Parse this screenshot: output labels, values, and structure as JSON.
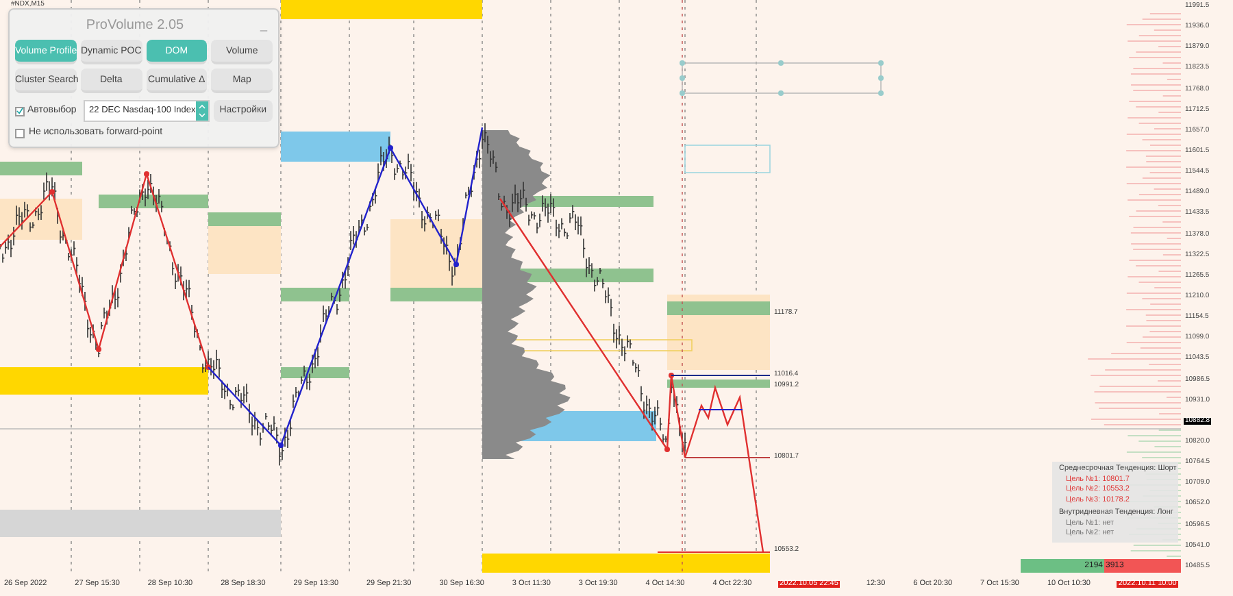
{
  "symbol": "#NDX,M15",
  "panel": {
    "title": "ProVolume 2.05",
    "minimize": "_",
    "modes": [
      {
        "label": "Volume Profile",
        "selected": true
      },
      {
        "label": "Dynamic POC",
        "selected": false
      },
      {
        "label": "DOM",
        "selected": true
      },
      {
        "label": "Volume",
        "selected": false
      },
      {
        "label": "Cluster Search",
        "selected": false
      },
      {
        "label": "Delta",
        "selected": false
      },
      {
        "label": "Cumulative Δ",
        "selected": false
      },
      {
        "label": "Map",
        "selected": false
      }
    ],
    "autoselect": {
      "label": "Автовыбор",
      "checked": true
    },
    "instrument": {
      "value": "22 DEC Nasdaq-100 Index"
    },
    "settings_button": "Настройки",
    "forward_point": {
      "label": "Не использовать forward-point",
      "checked": false
    }
  },
  "level_labels": [
    "11178.7",
    "11016.4",
    "10991.2",
    "10801.7",
    "10553.2"
  ],
  "price_axis": [
    {
      "label": "11991.5",
      "current": false
    },
    {
      "label": "11936.0",
      "current": false
    },
    {
      "label": "11879.0",
      "current": false
    },
    {
      "label": "11823.5",
      "current": false
    },
    {
      "label": "11768.0",
      "current": false
    },
    {
      "label": "11712.5",
      "current": false
    },
    {
      "label": "11657.0",
      "current": false
    },
    {
      "label": "11601.5",
      "current": false
    },
    {
      "label": "11544.5",
      "current": false
    },
    {
      "label": "11489.0",
      "current": false
    },
    {
      "label": "11433.5",
      "current": false
    },
    {
      "label": "11378.0",
      "current": false
    },
    {
      "label": "11322.5",
      "current": false
    },
    {
      "label": "11265.5",
      "current": false
    },
    {
      "label": "11210.0",
      "current": false
    },
    {
      "label": "11154.5",
      "current": false
    },
    {
      "label": "11099.0",
      "current": false
    },
    {
      "label": "11043.5",
      "current": false
    },
    {
      "label": "10986.5",
      "current": false
    },
    {
      "label": "10931.0",
      "current": false
    },
    {
      "label": "10882.8",
      "current": true
    },
    {
      "label": "10820.0",
      "current": false
    },
    {
      "label": "10764.5",
      "current": false
    },
    {
      "label": "10709.0",
      "current": false
    },
    {
      "label": "10652.0",
      "current": false
    },
    {
      "label": "10596.5",
      "current": false
    },
    {
      "label": "10541.0",
      "current": false
    },
    {
      "label": "10485.5",
      "current": false
    }
  ],
  "time_axis": [
    {
      "label": "26 Sep 2022",
      "highlighted": false
    },
    {
      "label": "27 Sep 15:30",
      "highlighted": false
    },
    {
      "label": "28 Sep 10:30",
      "highlighted": false
    },
    {
      "label": "28 Sep 18:30",
      "highlighted": false
    },
    {
      "label": "29 Sep 13:30",
      "highlighted": false
    },
    {
      "label": "29 Sep 21:30",
      "highlighted": false
    },
    {
      "label": "30 Sep 16:30",
      "highlighted": false
    },
    {
      "label": "3 Oct 11:30",
      "highlighted": false
    },
    {
      "label": "3 Oct 19:30",
      "highlighted": false
    },
    {
      "label": "4 Oct 14:30",
      "highlighted": false
    },
    {
      "label": "4 Oct 22:30",
      "highlighted": false
    },
    {
      "label": "2022.10.05 22:45",
      "highlighted": true
    },
    {
      "label": "12:30",
      "highlighted": false
    },
    {
      "label": "6 Oct 20:30",
      "highlighted": false
    },
    {
      "label": "7 Oct 15:30",
      "highlighted": false
    },
    {
      "label": "10 Oct 10:30",
      "highlighted": false
    },
    {
      "label": "2022.10.11 10:00",
      "highlighted": true
    }
  ],
  "trend_box": {
    "sections": [
      {
        "title": "Среднесрочная Тенденция: Шорт",
        "targets": [
          {
            "label": "Цель №1: 10801.7",
            "color": "#e03c3c"
          },
          {
            "label": "Цель №2: 10553.2",
            "color": "#e03c3c"
          },
          {
            "label": "Цель №3: 10178.2",
            "color": "#e03c3c"
          }
        ]
      },
      {
        "title": "Внутридневная Тенденция: Лонг",
        "targets": [
          {
            "label": "Цель №1: нет",
            "color": "#777777"
          },
          {
            "label": "Цель №2: нет",
            "color": "#777777"
          }
        ]
      }
    ]
  },
  "volume_bar": {
    "buy": "2194",
    "sell": "3913"
  }
}
